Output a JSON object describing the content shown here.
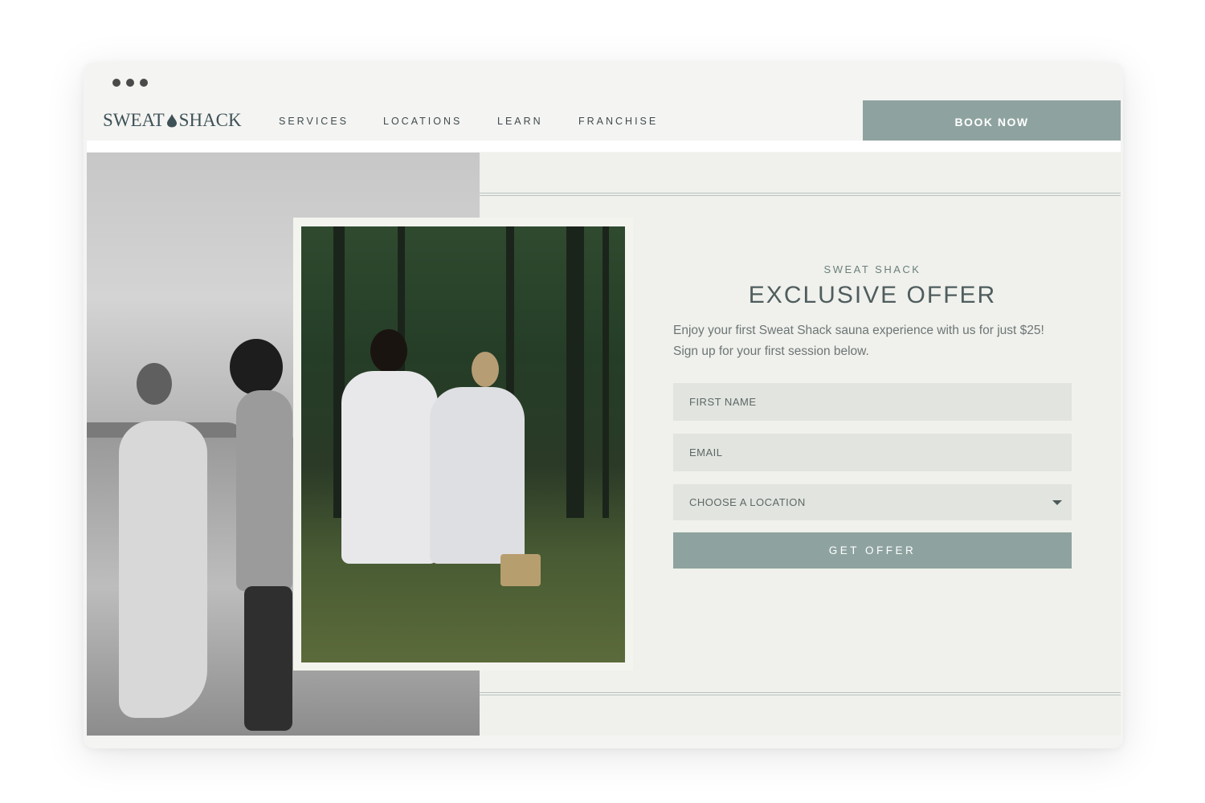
{
  "brand": {
    "name_left": "SWEAT",
    "name_right": "SHACK"
  },
  "nav": {
    "links": [
      "SERVICES",
      "LOCATIONS",
      "LEARN",
      "FRANCHISE"
    ],
    "cta": "BOOK NOW"
  },
  "offer": {
    "eyebrow": "SWEAT SHACK",
    "headline": "EXCLUSIVE OFFER",
    "description": "Enjoy your first Sweat Shack sauna experience with us for just $25! Sign up for your first session below.",
    "first_name_placeholder": "FIRST NAME",
    "email_placeholder": "EMAIL",
    "location_select": "CHOOSE A LOCATION",
    "submit": "GET OFFER"
  },
  "colors": {
    "accent": "#8ea39f",
    "background": "#f0f1ec",
    "text_dark": "#4f5d5e",
    "field_bg": "#e2e4df"
  },
  "icons": [
    "droplet-icon",
    "dropdown-caret-icon"
  ]
}
